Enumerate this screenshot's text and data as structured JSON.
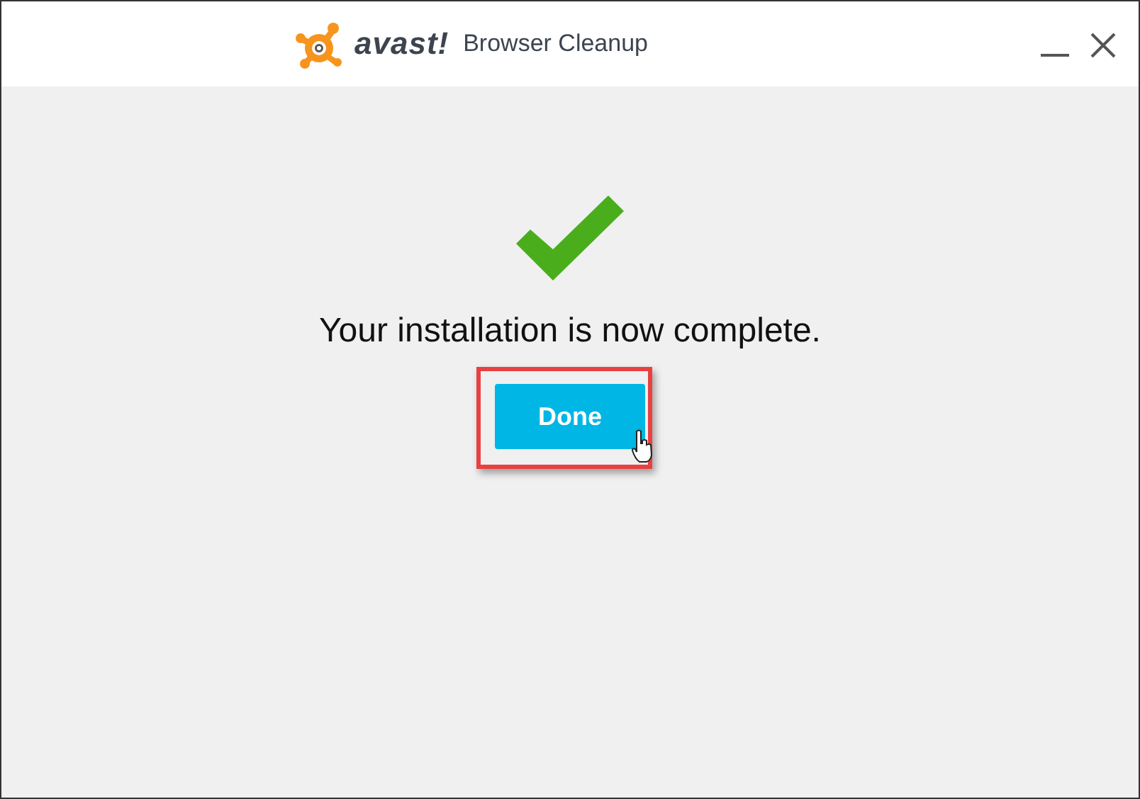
{
  "window": {
    "logo_text": "avast!",
    "title": "Browser Cleanup"
  },
  "message": "Your installation is now complete.",
  "button": {
    "label": "Done",
    "highlighted": true
  }
}
